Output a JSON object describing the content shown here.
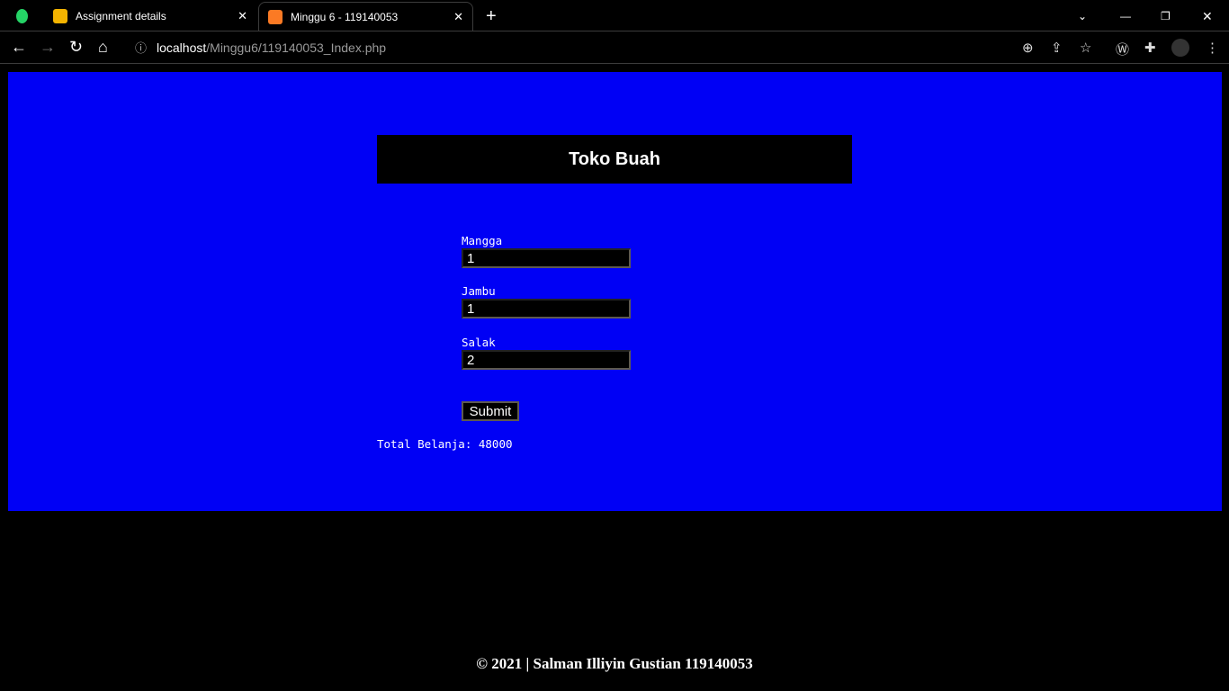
{
  "browser": {
    "tabs": [
      {
        "label": "Assignment details",
        "icon": "google-classroom-icon"
      },
      {
        "label": "Minggu 6 - 119140053",
        "icon": "xampp-icon",
        "active": true
      }
    ],
    "url_host": "localhost",
    "url_path": "/Minggu6/119140053_Index.php"
  },
  "page": {
    "title": "Toko Buah",
    "fields": [
      {
        "label": "Mangga",
        "value": "1"
      },
      {
        "label": "Jambu",
        "value": "1"
      },
      {
        "label": "Salak",
        "value": "2"
      }
    ],
    "submit_label": "Submit",
    "total": "Total Belanja: 48000",
    "footer": "© 2021 | Salman Illiyin Gustian 119140053",
    "colors": {
      "background": "#0000f5",
      "header": "#000000"
    }
  }
}
